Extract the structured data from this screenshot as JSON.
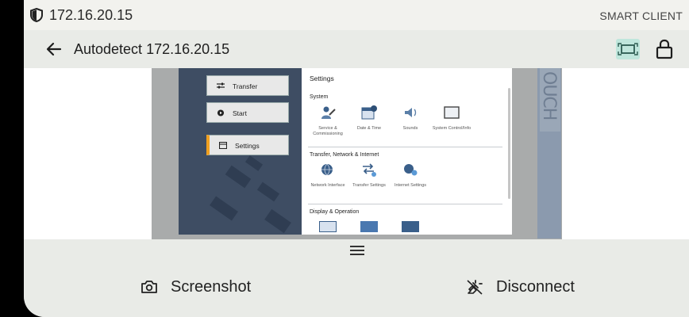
{
  "status": {
    "ip": "172.16.20.15",
    "mode": "SMART CLIENT",
    "shield_icon": "shield-icon"
  },
  "header": {
    "title": "Autodetect 172.16.20.15",
    "back_icon": "arrow-left-icon",
    "fit_icon": "fit-screen-icon",
    "lock_icon": "lock-icon",
    "accent": "#bfe6dc"
  },
  "remote": {
    "sidebar_buttons": [
      {
        "label": "Transfer",
        "icon": "transfer-icon"
      },
      {
        "label": "Start",
        "icon": "play-icon"
      },
      {
        "label": "Settings",
        "icon": "settings-window-icon",
        "active": true
      }
    ],
    "panel_title": "Settings",
    "sections": [
      {
        "title": "System",
        "items": [
          "Service & Commissioning",
          "Date & Time",
          "Sounds",
          "System Control/Info"
        ]
      },
      {
        "title": "Transfer, Network & Internet",
        "items": [
          "Network Interface",
          "Transfer Settings",
          "Internet Settings"
        ]
      },
      {
        "title": "Display & Operation",
        "items": []
      }
    ],
    "brand_text": "OUCH"
  },
  "toolbar": {
    "screenshot_label": "Screenshot",
    "disconnect_label": "Disconnect",
    "handle_icon": "menu-icon"
  }
}
